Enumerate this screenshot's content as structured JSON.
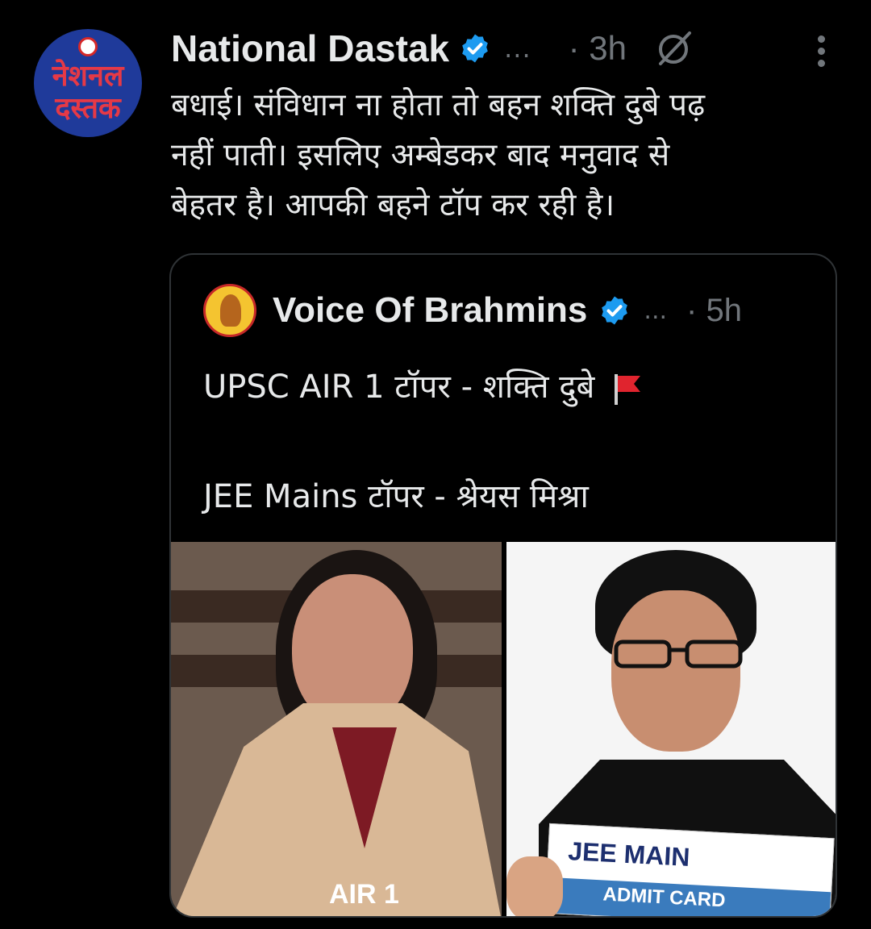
{
  "tweet": {
    "avatar_text_line1": "नेशनल",
    "avatar_text_line2": "दस्तक",
    "author": "National Dastak",
    "truncation": "...",
    "time": "· 3h",
    "text": "बधाई। संविधान ना होता तो बहन शक्ति दुबे पढ़\nनहीं पाती। इसलिए अम्बेडकर बाद मनुवाद से\nबेहतर है। आपकी बहने टॉप कर रही है।"
  },
  "quoted": {
    "author": "Voice Of Brahmins",
    "truncation": "...",
    "time": "· 5h",
    "line1": "UPSC AIR 1 टॉपर - शक्ति दुबे",
    "line2": "JEE Mains टॉपर - श्रेयस मिश्रा",
    "image_left_caption": "AIR 1",
    "image_right_card_title": "JEE MAIN",
    "image_right_card_subtitle": "ADMIT CARD"
  },
  "colors": {
    "background": "#000000",
    "text": "#e7e9ea",
    "secondary": "#71767b",
    "verified": "#1d9bf0",
    "border": "#2f3336"
  },
  "icons": [
    "verified-badge-icon",
    "grok-icon",
    "more-options-icon",
    "red-flag-icon"
  ]
}
